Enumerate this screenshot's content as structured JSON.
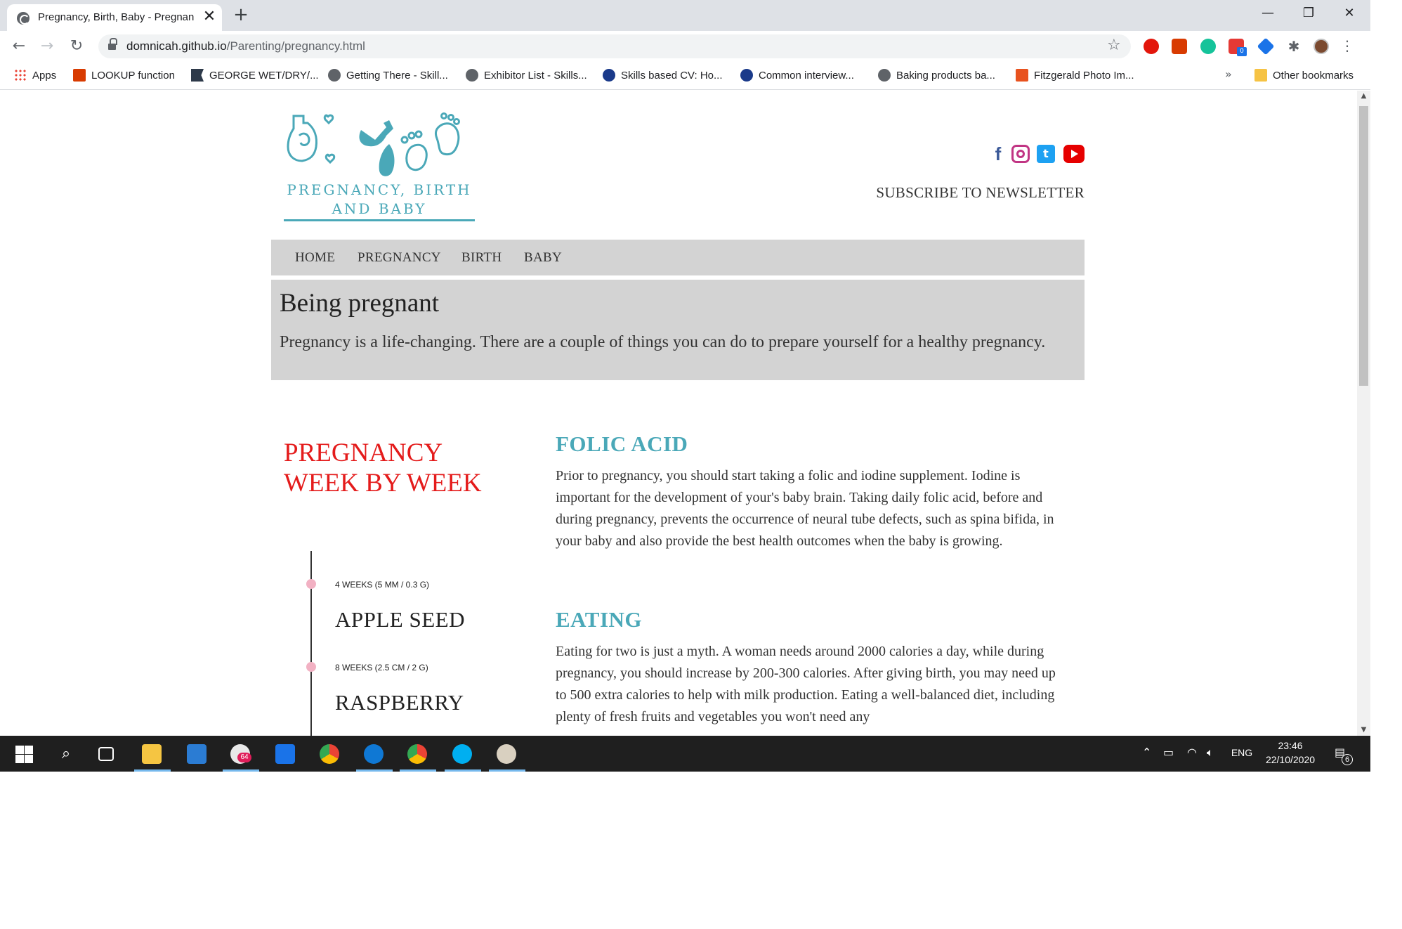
{
  "browser": {
    "tab_title": "Pregnancy, Birth, Baby - Pregnan",
    "tab_close": "✕",
    "new_tab": "+",
    "window_controls": [
      "—",
      "❐",
      "✕"
    ],
    "url_host": "domnicah.github.io",
    "url_path": "/Parenting/pregnancy.html",
    "bookmarks": [
      {
        "label": "Apps",
        "icon": "apps-grid-icon"
      },
      {
        "label": "LOOKUP function",
        "icon": "office-icon"
      },
      {
        "label": "GEORGE WET/DRY/...",
        "icon": "flag-icon"
      },
      {
        "label": "Getting There - Skill...",
        "icon": "globe-icon"
      },
      {
        "label": "Exhibitor List - Skills...",
        "icon": "globe-icon"
      },
      {
        "label": "Skills based CV: Ho...",
        "icon": "site-icon"
      },
      {
        "label": "Common interview...",
        "icon": "site-icon"
      },
      {
        "label": "Baking products ba...",
        "icon": "globe-icon"
      },
      {
        "label": "Fitzgerald Photo Im...",
        "icon": "photo-icon"
      }
    ],
    "bookmarks_more": "»",
    "other_bookmarks": "Other bookmarks",
    "calendar_badge": "0"
  },
  "site": {
    "logo_text_line1": "PREGNANCY, BIRTH",
    "logo_text_line2": "AND BABY",
    "subscribe": "SUBSCRIBE TO NEWSLETTER",
    "nav": [
      "HOME",
      "PREGNANCY",
      "BIRTH",
      "BABY"
    ],
    "hero": {
      "title": "Being pregnant",
      "text": "Pregnancy is a life-changing. There are a couple of things you can do to prepare yourself for a healthy pregnancy."
    },
    "week_title": "PREGNANCY WEEK BY WEEK",
    "timeline": [
      {
        "sub": "4 WEEKS (5 MM / 0.3 G)",
        "name": "APPLE SEED"
      },
      {
        "sub": "8 WEEKS (2.5 CM / 2 G)",
        "name": "RASPBERRY"
      }
    ],
    "sections": [
      {
        "title": "FOLIC ACID",
        "text": "Prior to pregnancy, you should start taking a folic and iodine supplement. Iodine is important for the development of your's baby brain. Taking daily folic acid, before and during pregnancy, prevents the occurrence of neural tube defects, such as spina bifida, in your baby and also provide the best health outcomes when the baby is growing."
      },
      {
        "title": "EATING",
        "text": "Eating for two is just a myth. A woman needs around 2000 calories a day, while during pregnancy, you should increase by 200-300 calories. After giving birth, you may need up to 500 extra calories to help with milk production. Eating a well-balanced diet, including plenty of fresh fruits and vegetables you won't need any"
      }
    ],
    "colors": {
      "accent_teal": "#4aa8b8",
      "heading_red": "#e41b1b",
      "nav_grey": "#d3d3d3",
      "timeline_dot": "#f2b1c3"
    }
  },
  "taskbar": {
    "lang": "ENG",
    "time": "23:46",
    "date": "22/10/2020",
    "notifications": "6",
    "slack_badge": "64"
  }
}
